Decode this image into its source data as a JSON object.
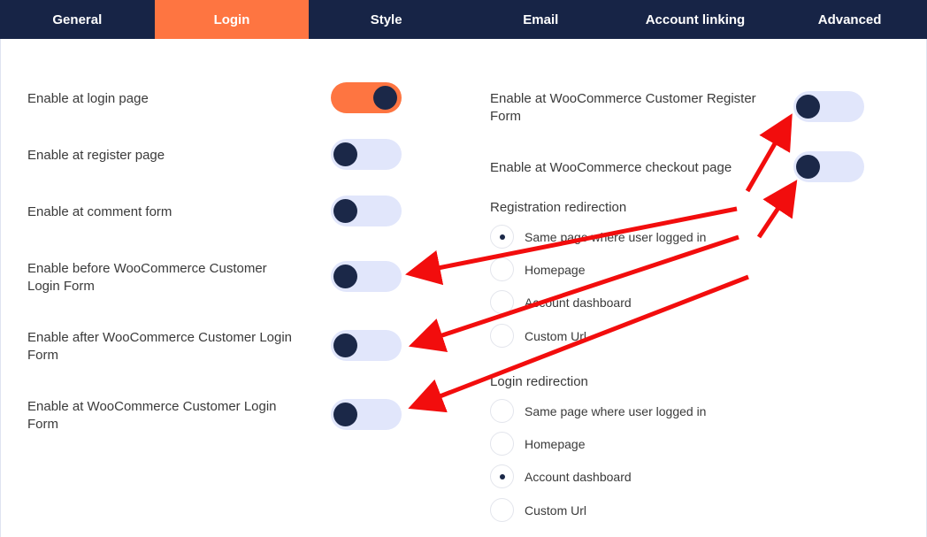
{
  "tabs": [
    {
      "label": "General",
      "active": false
    },
    {
      "label": "Login",
      "active": true
    },
    {
      "label": "Style",
      "active": false
    },
    {
      "label": "Email",
      "active": false
    },
    {
      "label": "Account linking",
      "active": false
    },
    {
      "label": "Advanced",
      "active": false
    }
  ],
  "left_settings": [
    {
      "label_lines": [
        "Enable at login page"
      ],
      "enabled": true
    },
    {
      "label_lines": [
        "Enable at register page"
      ],
      "enabled": false
    },
    {
      "label_lines": [
        "Enable at comment form"
      ],
      "enabled": false
    },
    {
      "label_lines": [
        "Enable before WooCommerce Customer",
        "Login Form"
      ],
      "enabled": false
    },
    {
      "label_lines": [
        "Enable after WooCommerce Customer Login",
        "Form"
      ],
      "enabled": false
    },
    {
      "label_lines": [
        "Enable at WooCommerce Customer Login",
        "Form"
      ],
      "enabled": false
    }
  ],
  "right_settings": [
    {
      "label_lines": [
        "Enable at WooCommerce Customer Register",
        "Form"
      ],
      "enabled": false
    },
    {
      "label_lines": [
        "Enable at WooCommerce checkout page"
      ],
      "enabled": false
    }
  ],
  "registration_redirection": {
    "title": "Registration redirection",
    "options": [
      "Same page where user logged in",
      "Homepage",
      "Account dashboard",
      "Custom Url"
    ],
    "selected": 0
  },
  "login_redirection": {
    "title": "Login redirection",
    "options": [
      "Same page where user logged in",
      "Homepage",
      "Account dashboard",
      "Custom Url"
    ],
    "selected": 2
  },
  "colors": {
    "tab_bar": "#172446",
    "tab_active": "#fe7541",
    "toggle_on": "#fe7541",
    "toggle_off": "#e1e6fb",
    "knob": "#1b2848",
    "annotation_arrow": "#f20d0d"
  }
}
